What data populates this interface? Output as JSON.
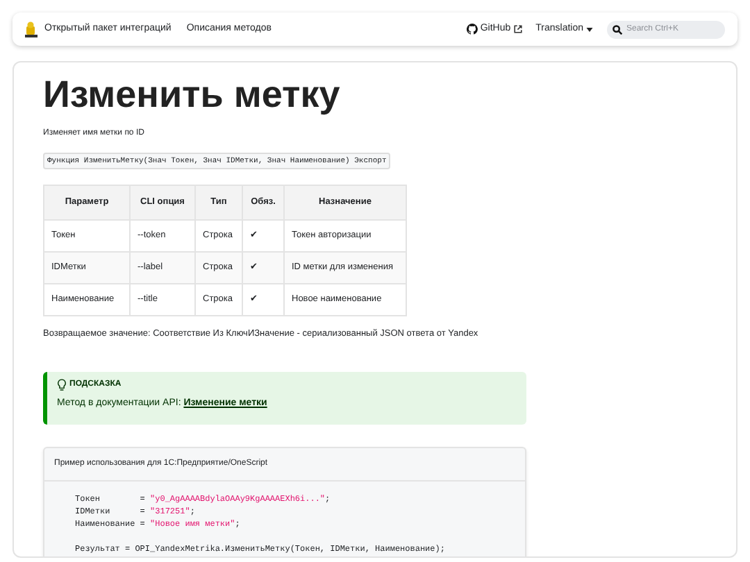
{
  "navbar": {
    "links": [
      {
        "label": "Открытый пакет интеграций"
      },
      {
        "label": "Описания методов"
      }
    ],
    "github": {
      "label": "GitHub"
    },
    "translation": {
      "label": "Translation"
    },
    "search": {
      "placeholder": "Search Ctrl+K"
    }
  },
  "page": {
    "title": "Изменить метку",
    "description": "Изменяет имя метки по ID",
    "signature": "Функция ИзменитьМетку(Знач Токен, Знач IDМетки, Знач Наименование) Экспорт",
    "table": {
      "columns": [
        "Параметр",
        "CLI опция",
        "Тип",
        "Обяз.",
        "Назначение"
      ],
      "rows": [
        [
          "Токен",
          "--token",
          "Строка",
          "✔",
          "Токен авторизации"
        ],
        [
          "IDМетки",
          "--label",
          "Строка",
          "✔",
          "ID метки для изменения"
        ],
        [
          "Наименование",
          "--title",
          "Строка",
          "✔",
          "Новое наименование"
        ]
      ]
    },
    "returns": "Возвращаемое значение: Соответствие Из КлючИЗначение - сериализованный JSON ответа от Yandex",
    "tip": {
      "title": "ПОДСКАЗКА",
      "text": "Метод в документации API: ",
      "link": "Изменение метки"
    },
    "example": {
      "title": "Пример использования для 1С:Предприятие/OneScript",
      "lines": [
        {
          "kind": "assign",
          "name": "Токен        = ",
          "value": "\"y0_AgAAAABdylaOAAy9KgAAAAEXh6i...\"",
          "end": ";"
        },
        {
          "kind": "assign",
          "name": "IDМетки      = ",
          "value": "\"317251\"",
          "end": ";"
        },
        {
          "kind": "assign",
          "name": "Наименование = ",
          "value": "\"Новое имя метки\"",
          "end": ";"
        },
        {
          "kind": "blank"
        },
        {
          "kind": "plain",
          "text": "Результат = OPI_YandexMetrika.ИзменитьМетку(Токен, IDМетки, Наименование);"
        }
      ]
    }
  }
}
